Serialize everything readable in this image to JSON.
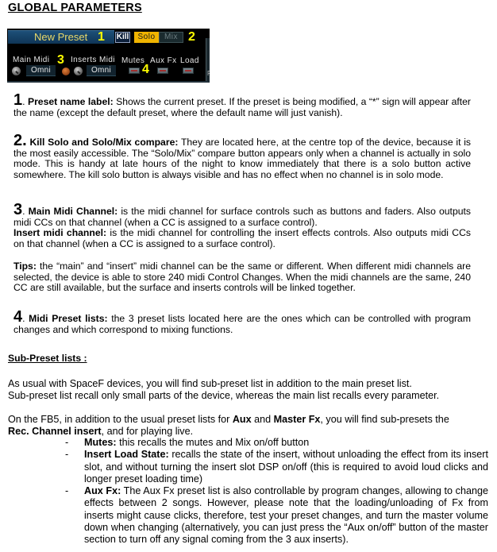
{
  "heading": "GLOBAL PARAMETERS",
  "panel": {
    "preset_name": "New Preset",
    "badges": [
      "1",
      "2",
      "3",
      "4"
    ],
    "kill_label": "Kill",
    "solo_label": "Solo",
    "mix_label": "Mix",
    "main_midi_label": "Main Midi",
    "inserts_midi_label": "Inserts Midi",
    "main_midi_value": "Omni",
    "inserts_midi_value": "Omni",
    "mutes_label": "Mutes",
    "aux_fx_label": "Aux Fx",
    "load_label": "Load",
    "side_letter": "F",
    "colors": {
      "preset_text": "#e8d86a",
      "solo_active": "#f0b400",
      "badge": "#ffff00"
    }
  },
  "sections": [
    {
      "number": "1",
      "title": "Preset name label:",
      "body": " Shows the current preset. If the preset is being modified, a “*” sign will appear after the name (except the default preset, where the default name will just vanish)."
    },
    {
      "number": "2.",
      "title": "Kill Solo and Solo/Mix compare:",
      "body": " They are located here, at the centre top of the device, because it is the most easily accessible. The “Solo/Mix” compare button appears only when a channel is actually in solo mode. This is handy at late hours of the night to know immediately that there is a solo button active somewhere. The kill solo button is always visible and has no effect when no channel is in solo mode."
    },
    {
      "number": "3",
      "title": "Main Midi Channel:",
      "body": " is the midi channel for surface controls such as buttons and faders. Also outputs midi CCs on that channel (when a CC is assigned to a surface control).",
      "extra_title": "Insert midi channel:",
      "extra_body": " is the midi channel for controlling the insert effects controls. Also outputs midi CCs on that channel (when a CC is assigned to a surface control)."
    },
    {
      "title": "Tips:",
      "body": "  the “main” and “insert” midi channel can be the same or different. When different midi channels are selected, the device is able to store 240 midi Control Changes. When the midi channels are the same, 240 CC are still available, but the surface and inserts controls will be linked together."
    },
    {
      "number": "4",
      "title": "Midi Preset lists:",
      "body": " the 3 preset lists located here are the ones which can be controlled with program changes and which correspond to mixing functions."
    }
  ],
  "sub_preset": {
    "heading": "Sub-Preset lists :",
    "para1_line1": "As usual with SpaceF devices, you will find sub-preset list in addition to the main preset list.",
    "para1_line2": "Sub-preset list recall only small parts of the device, whereas the main list recalls every parameter.",
    "para2_a": "On the FB5, in addition to the usual preset lists for ",
    "para2_aux": "Aux",
    "para2_b": " and ",
    "para2_master": "Master Fx",
    "para2_c": ", you will find sub-presets the ",
    "para2_rec": "Rec. Channel insert",
    "para2_d": ", and  for playing live.",
    "items": [
      {
        "title": "Mutes:",
        "body": " this recalls the mutes and Mix on/off button"
      },
      {
        "title": "Insert Load State:",
        "body": " recalls the state of the insert, without unloading the effect from its insert slot, and without turning the insert slot DSP on/off (this is required to avoid loud clicks and longer preset loading time)"
      },
      {
        "title": "Aux Fx:",
        "body": " The Aux Fx preset list is also controllable by program changes, allowing to change effects between 2 songs. However, please note that the loading/unloading of Fx from inserts might cause clicks, therefore, test your preset changes, and turn the master volume down when changing (alternatively, you can just press the “Aux on/off” button of the master section to turn off any signal coming from the 3 aux inserts)."
      }
    ],
    "dash": "-"
  }
}
